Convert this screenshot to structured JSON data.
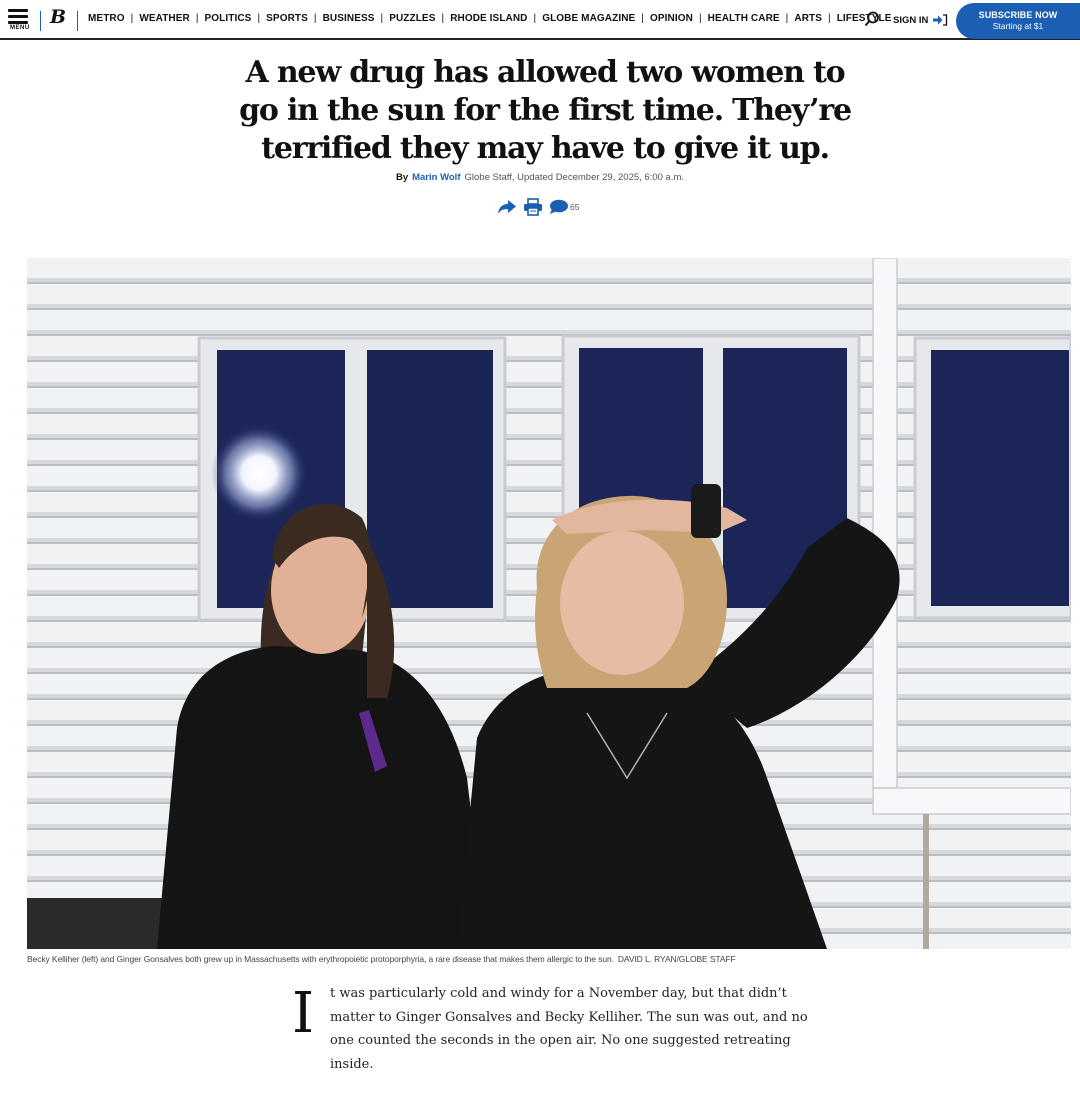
{
  "header": {
    "menu_label": "MENU",
    "logo": "B",
    "nav_items": [
      "METRO",
      "WEATHER",
      "POLITICS",
      "SPORTS",
      "BUSINESS",
      "PUZZLES",
      "RHODE ISLAND",
      "GLOBE MAGAZINE",
      "OPINION",
      "HEALTH CARE",
      "ARTS",
      "LIFESTYLE"
    ],
    "signin_label": "SIGN IN",
    "subscribe_line1": "SUBSCRIBE NOW",
    "subscribe_line2": "Starting at $1",
    "accent_color": "#1a5fb4"
  },
  "article": {
    "headline": "A new drug has allowed two women to go in the sun for the first time. They’re terrified they may have to give it up.",
    "by_label": "By",
    "author": "Marin Wolf",
    "meta": "Globe Staff, Updated December 29, 2025, 6:00 a.m.",
    "comment_count": "65",
    "tools": [
      "share-icon",
      "print-icon",
      "comment-icon"
    ]
  },
  "photo": {
    "caption": "Becky Kelliher (left) and Ginger Gonsalves both grew up in Massachusetts with erythropoietic protoporphyria, a rare disease that makes them allergic to the sun.",
    "credit": "DAVID L. RYAN/GLOBE STAFF"
  },
  "body": {
    "dropcap": "I",
    "first_paragraph": "t was particularly cold and windy for a November day, but that didn’t matter to Ginger Gonsalves and Becky Kelliher. The sun was out, and no one counted the seconds in the open air. No one suggested retreating inside."
  }
}
